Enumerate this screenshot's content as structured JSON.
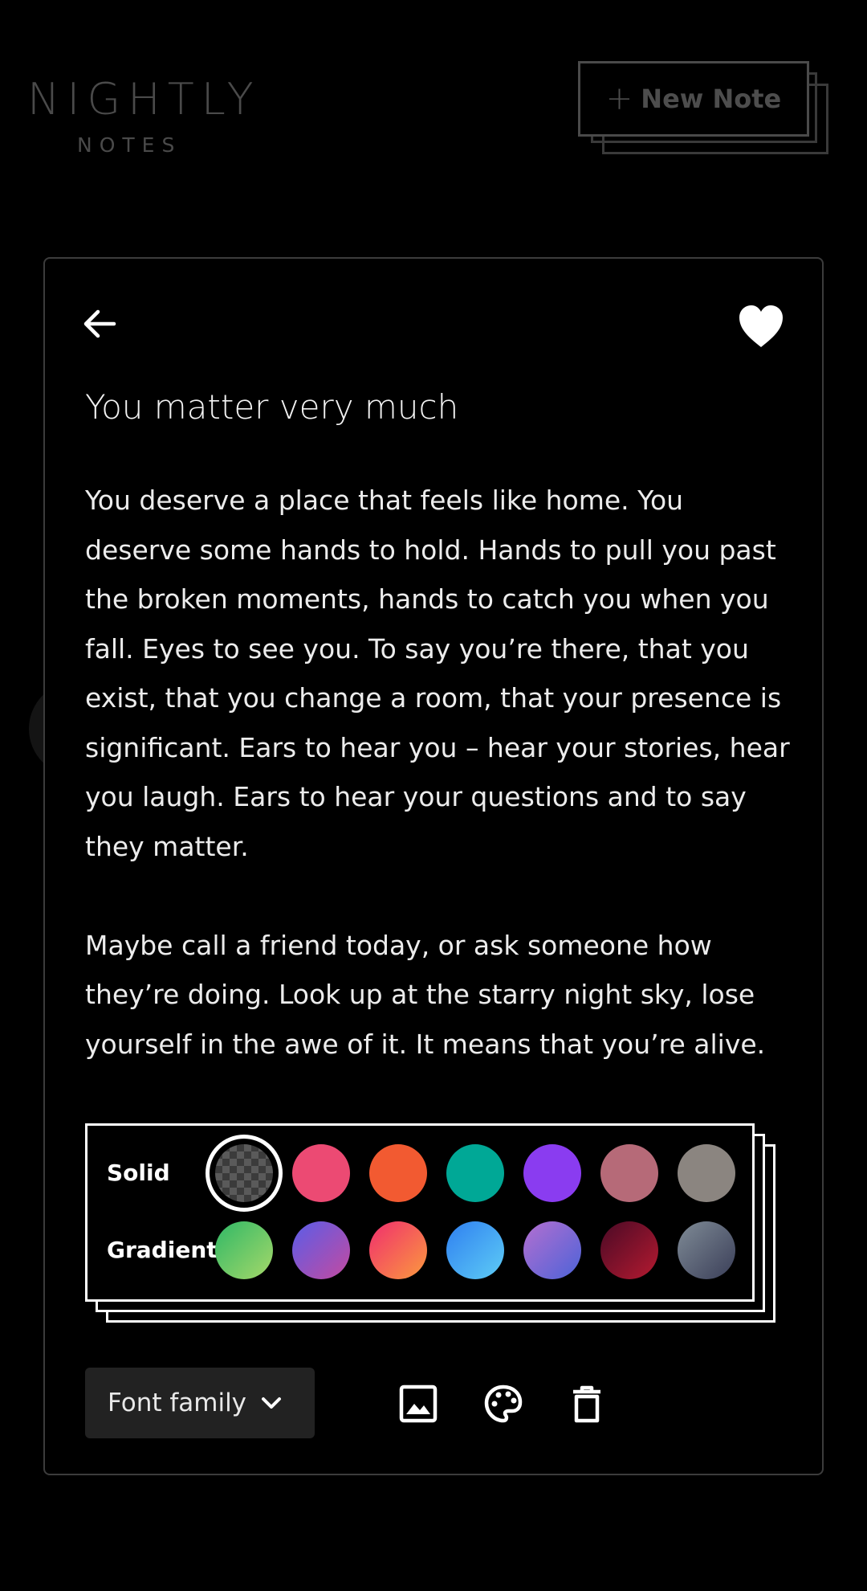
{
  "app": {
    "logo_name": "NIGHTLY",
    "logo_sub": "NOTES",
    "new_note_label": "New Note"
  },
  "note": {
    "title": "You matter very much",
    "body": "You deserve a place that feels like home. You deserve some hands to hold. Hands to pull you past the broken moments, hands to catch you when you fall. Eyes to see you. To say you’re there, that you exist, that you change a room, that your presence is significant. Ears to hear you – hear your stories, hear you laugh. Ears to hear your questions and to say they matter.\n\nMaybe call a friend today, or ask someone how they’re doing. Look up at the starry night sky, lose yourself in the awe of it. It means that you’re alive.",
    "favorited": true
  },
  "palette": {
    "solid_label": "Solid",
    "gradient_label": "Gradient",
    "solid": [
      {
        "name": "transparent",
        "value": "checker",
        "selected": true
      },
      {
        "name": "pink",
        "value": "#ec4a73"
      },
      {
        "name": "orange",
        "value": "#f25a31"
      },
      {
        "name": "teal",
        "value": "#00a896"
      },
      {
        "name": "purple",
        "value": "#8a3cf0"
      },
      {
        "name": "rose",
        "value": "#b66a78"
      },
      {
        "name": "taupe",
        "value": "#8b8580"
      }
    ],
    "gradient": [
      {
        "name": "green",
        "value": "linear-gradient(135deg,#2fb866,#a6d86a)"
      },
      {
        "name": "indigo-magenta",
        "value": "linear-gradient(135deg,#5a5de8,#c44aa0)"
      },
      {
        "name": "pink-orange",
        "value": "linear-gradient(135deg,#f02e6e,#fb9a3e)"
      },
      {
        "name": "blue",
        "value": "linear-gradient(135deg,#2f7ff0,#5ecdf6)"
      },
      {
        "name": "lilac-blue",
        "value": "linear-gradient(135deg,#b46fd0,#4c63d8)"
      },
      {
        "name": "wine",
        "value": "linear-gradient(135deg,#4a0a26,#b51a30)"
      },
      {
        "name": "slate",
        "value": "linear-gradient(135deg,#7f8b96,#3a3e58)"
      }
    ]
  },
  "toolbar": {
    "font_family_label": "Font family"
  }
}
